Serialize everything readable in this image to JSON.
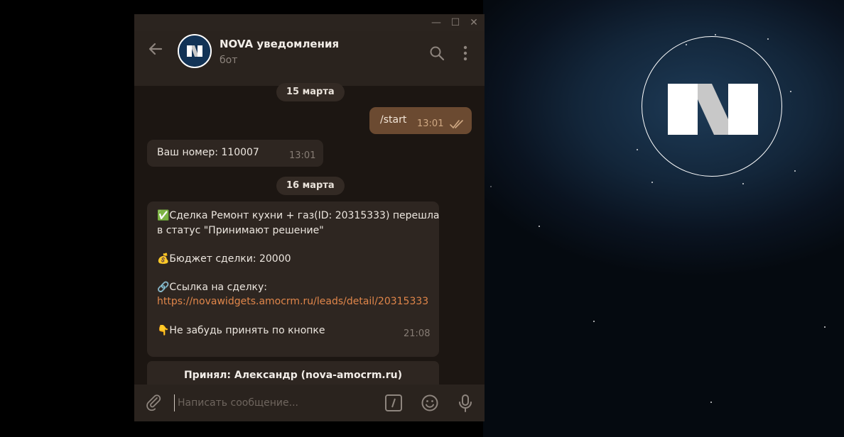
{
  "window": {
    "title_buttons": [
      "minimize",
      "maximize",
      "close"
    ]
  },
  "header": {
    "title": "NOVA уведомления",
    "subtitle": "бот"
  },
  "messages": {
    "date_1": "15 марта",
    "out_1": {
      "text": "/start",
      "time": "13:01"
    },
    "in_1": {
      "text": "Ваш номер: 110007",
      "time": "13:01"
    },
    "date_2": "16 марта",
    "in_2": {
      "line_1": "✅Сделка Ремонт кухни + газ(ID: 20315333) перешла",
      "line_2": "в статус \"Принимают решение\"",
      "line_3": "💰Бюджет сделки: 20000",
      "line_4": "🔗Ссылка на сделку:",
      "link": "https://novawidgets.amocrm.ru/leads/detail/20315333",
      "line_5": "👇Не забудь принять по кнопке",
      "time": "21:08"
    },
    "inline_button": "Принял: Александр (nova-amocrm.ru)"
  },
  "composer": {
    "placeholder": "Написать сообщение..."
  },
  "colors": {
    "accent_link": "#e0864a",
    "out_bubble": "#6b4a31",
    "in_bubble": "#2e2621"
  },
  "icons": [
    "back-arrow-icon",
    "search-icon",
    "more-vert-icon",
    "paperclip-icon",
    "bot-command-icon",
    "emoji-icon",
    "microphone-icon",
    "double-check-icon"
  ]
}
